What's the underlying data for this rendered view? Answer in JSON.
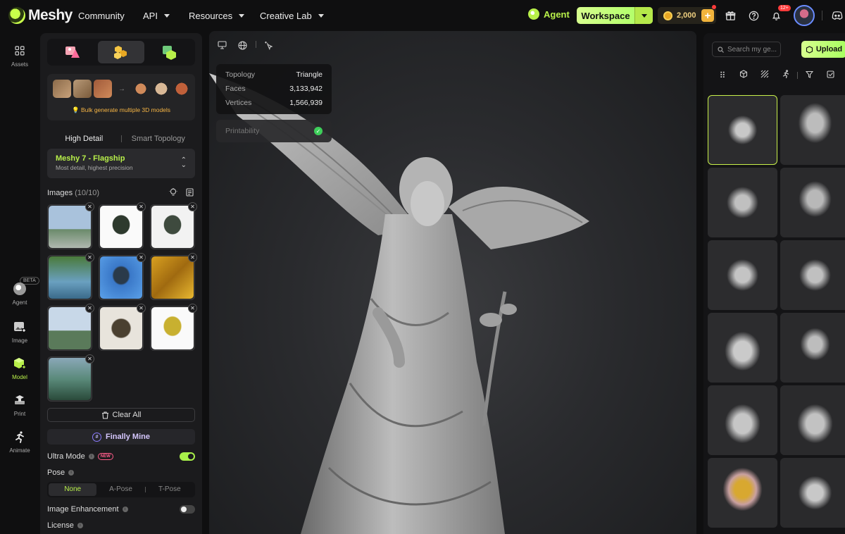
{
  "brand": {
    "name": "Meshy"
  },
  "nav": {
    "community": "Community",
    "api": "API",
    "resources": "Resources",
    "creative_lab": "Creative Lab",
    "agent": "Agent",
    "workspace": "Workspace",
    "credits": "2,000",
    "notif_count": "12+"
  },
  "rail": {
    "assets": "Assets",
    "beta": "BETA",
    "agent": "Agent",
    "image": "Image",
    "model": "Model",
    "print": "Print",
    "animate": "Animate"
  },
  "panel": {
    "bulk_text": "Bulk generate multiple 3D models",
    "detail_tabs": [
      "High Detail",
      "Smart Topology"
    ],
    "model_name": "Meshy 7 - Flagship",
    "model_desc": "Most detail, highest precision",
    "images_label": "Images",
    "images_count": "(10/10)",
    "clear_all": "Clear All",
    "finally_mine": "Finally Mine",
    "ultra_mode": "Ultra Mode",
    "new_tag": "NEW",
    "pose": "Pose",
    "pose_options": [
      "None",
      "A-Pose",
      "T-Pose"
    ],
    "image_enhancement": "Image Enhancement",
    "license": "License",
    "ultra_mode_on": true,
    "image_enhancement_on": false
  },
  "viewport": {
    "stats": [
      {
        "k": "Topology",
        "v": "Triangle"
      },
      {
        "k": "Faces",
        "v": "3,133,942"
      },
      {
        "k": "Vertices",
        "v": "1,566,939"
      }
    ],
    "printability": "Printability"
  },
  "assets": {
    "search_placeholder": "Search my ge...",
    "upload": "Upload"
  },
  "colors": {
    "accent": "#b8f04a",
    "background": "#0f0f10",
    "panel": "#1b1b1d"
  }
}
